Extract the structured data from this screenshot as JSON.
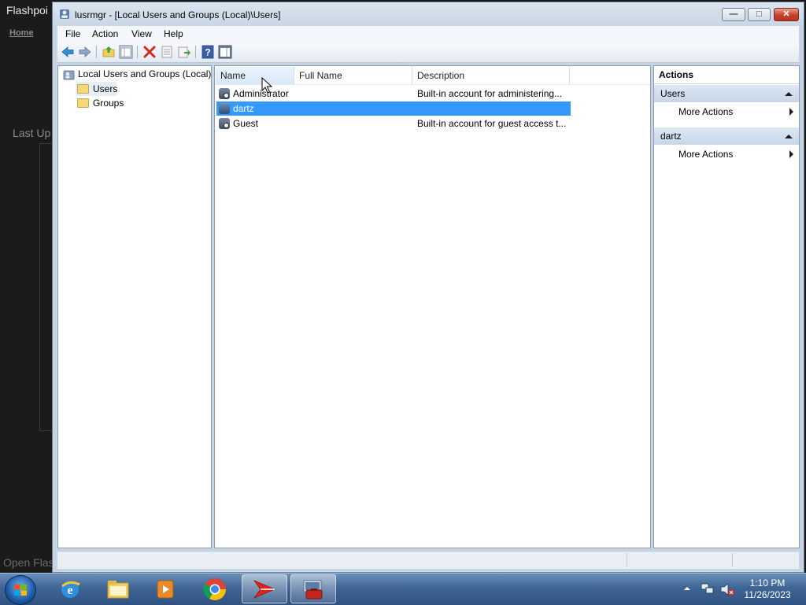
{
  "background_app": {
    "title": "Flashpoi",
    "home_link": "Home",
    "last_updated_label": "Last Up",
    "open_label": "Open Flas"
  },
  "window": {
    "title": "lusrmgr - [Local Users and Groups (Local)\\Users]",
    "controls": {
      "minimize": "—",
      "maximize": "□",
      "close": "✕"
    }
  },
  "menu": [
    "File",
    "Action",
    "View",
    "Help"
  ],
  "toolbar_icons": [
    "back-arrow-icon",
    "forward-arrow-icon",
    "up-folder-icon",
    "show-hide-tree-icon",
    "delete-icon",
    "properties-icon",
    "export-list-icon",
    "help-icon",
    "show-hide-action-pane-icon"
  ],
  "tree": {
    "root": "Local Users and Groups (Local)",
    "items": [
      "Users",
      "Groups"
    ],
    "selected": "Users"
  },
  "list": {
    "columns": [
      "Name",
      "Full Name",
      "Description"
    ],
    "rows": [
      {
        "name": "Administrator",
        "full_name": "",
        "description": "Built-in account for administering...",
        "icon": "disabled-user-icon"
      },
      {
        "name": "dartz",
        "full_name": "",
        "description": "",
        "icon": "user-icon",
        "selected": true
      },
      {
        "name": "Guest",
        "full_name": "",
        "description": "Built-in account for guest access t...",
        "icon": "disabled-user-icon"
      }
    ]
  },
  "actions": {
    "header": "Actions",
    "sections": [
      {
        "title": "Users",
        "items": [
          "More Actions"
        ]
      },
      {
        "title": "dartz",
        "items": [
          "More Actions"
        ]
      }
    ]
  },
  "taskbar": {
    "time": "1:10 PM",
    "date": "11/26/2023",
    "pinned": [
      "start-orb-icon",
      "internet-explorer-icon",
      "file-explorer-icon",
      "media-player-icon",
      "chrome-icon",
      "flashpoint-icon",
      "computer-management-icon"
    ]
  },
  "colors": {
    "selection": "#3399ff",
    "window_frame": "#c7d4e3",
    "taskbar": "#3f6594"
  }
}
